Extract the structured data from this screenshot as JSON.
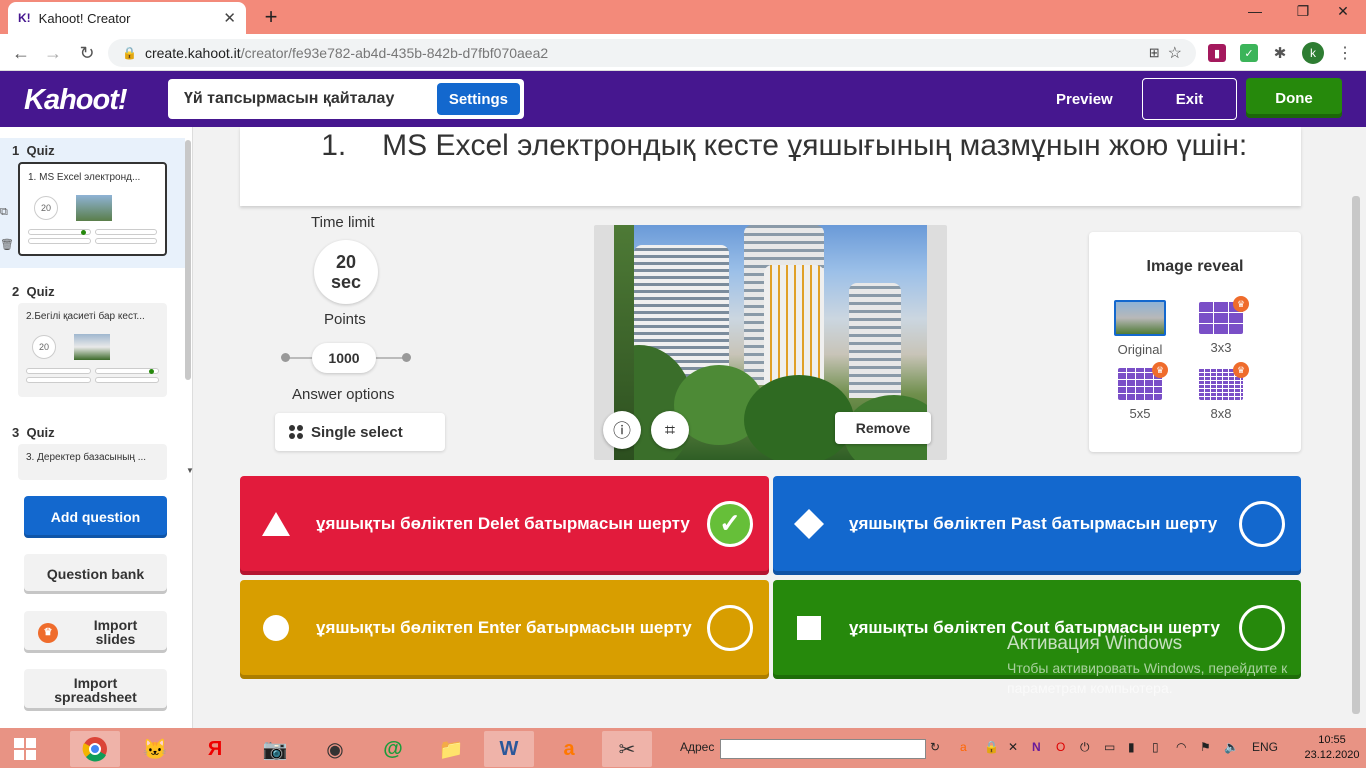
{
  "browser": {
    "tab_title": "Kahoot! Creator",
    "favicon": "K!",
    "url_host": "create.kahoot.it",
    "url_path": "/creator/fe93e782-ab4d-435b-842b-d7fbf070aea2",
    "profile_initial": "k"
  },
  "header": {
    "logo": "Kahoot!",
    "title": "Үй тапсырмасын қайталау",
    "settings": "Settings",
    "preview": "Preview",
    "exit": "Exit",
    "done": "Done"
  },
  "sidebar": {
    "slides": [
      {
        "index": "1",
        "type": "Quiz",
        "text": "1.      MS Excel электронд...",
        "time": "20"
      },
      {
        "index": "2",
        "type": "Quiz",
        "text": "2.Бегілі қасиеті бар кест...",
        "time": "20"
      },
      {
        "index": "3",
        "type": "Quiz",
        "text": "3. Деректер базасының ...",
        "time": ""
      }
    ],
    "add_question": "Add question",
    "question_bank": "Question bank",
    "import_slides": "Import slides",
    "import_spreadsheet": "Import spreadsheet"
  },
  "question": {
    "number": "1.",
    "text": "MS Excel электрондық кесте ұяшығының мазмұнын жою үшін:"
  },
  "settings_panel": {
    "time_label": "Time limit",
    "time_value": "20",
    "time_unit": "sec",
    "points_label": "Points",
    "points_value": "1000",
    "answer_options_label": "Answer options",
    "answer_options_value": "Single select"
  },
  "image": {
    "remove": "Remove"
  },
  "reveal": {
    "title": "Image reveal",
    "options": [
      "Original",
      "3x3",
      "5x5",
      "8x8"
    ]
  },
  "answers": [
    {
      "text": "ұяшықты бөліктеп Delet батырмасын шерту",
      "color": "#e21b3c",
      "shape": "triangle",
      "correct": true
    },
    {
      "text": "ұяшықты бөліктеп Past батырмасын шерту",
      "color": "#1368ce",
      "shape": "diamond",
      "correct": false
    },
    {
      "text": "ұяшықты бөліктеп Enter батырмасын шерту",
      "color": "#d89e00",
      "shape": "circle",
      "correct": false
    },
    {
      "text": "ұяшықты бөліктеп Cout батырмасын шерту",
      "color": "#26890c",
      "shape": "square",
      "correct": false
    }
  ],
  "watermark": {
    "line1": "Активация Windows",
    "line2": "Чтобы активировать Windows, перейдите к параметрам компьютера."
  },
  "taskbar": {
    "address_label": "Адрес",
    "lang": "ENG",
    "time": "10:55",
    "date": "23.12.2020"
  }
}
